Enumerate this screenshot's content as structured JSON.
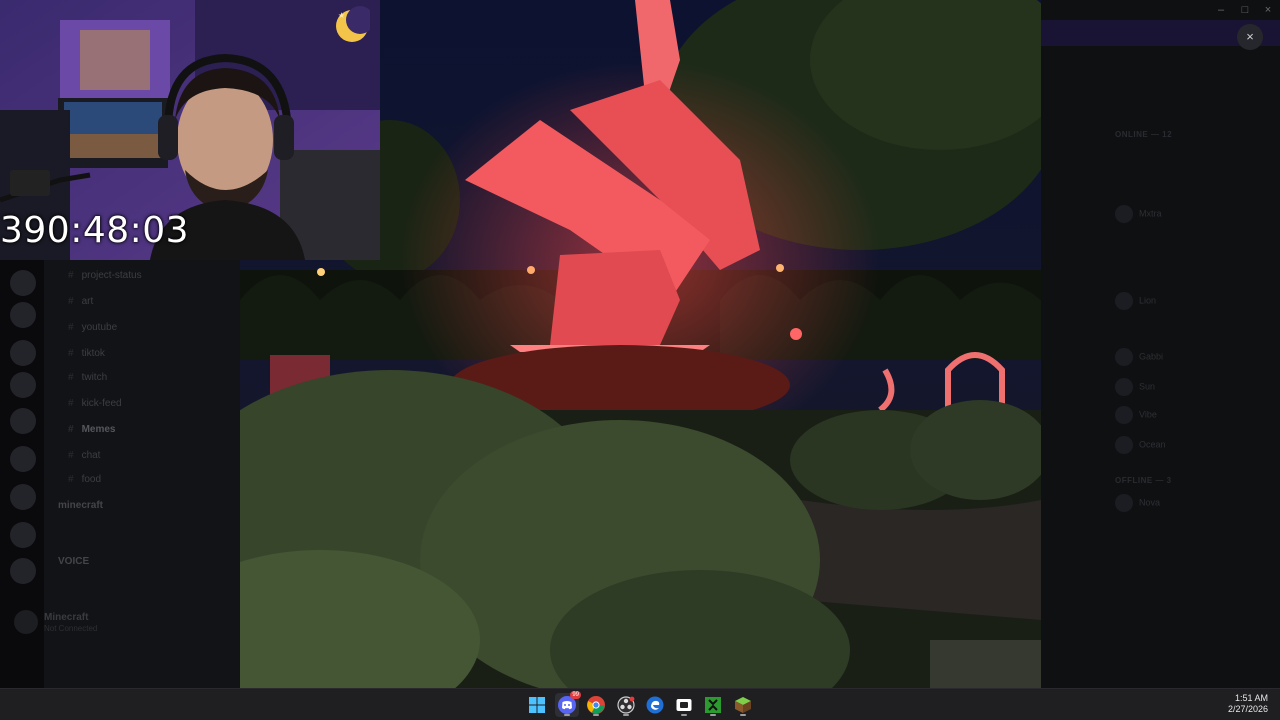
{
  "webcam": {
    "timer": "390:48:03"
  },
  "channels": {
    "items": [
      {
        "label": "project-status"
      },
      {
        "label": "art"
      },
      {
        "label": "youtube"
      },
      {
        "label": "tiktok"
      },
      {
        "label": "twitch"
      },
      {
        "label": "kick-feed"
      },
      {
        "label": "Memes"
      },
      {
        "label": "chat"
      },
      {
        "label": "food"
      }
    ],
    "categories": [
      "minecraft",
      "VOICE"
    ]
  },
  "server_footer": {
    "name": "Minecraft",
    "sub": "Not Connected"
  },
  "members": {
    "sections": [
      "ONLINE — 12",
      "OFFLINE — 3"
    ],
    "items": [
      {
        "name": "Mxtra"
      },
      {
        "name": "Lion"
      },
      {
        "name": "Gabbi"
      },
      {
        "name": "Sun"
      },
      {
        "name": "Vibe"
      },
      {
        "name": "Ocean"
      },
      {
        "name": "Nova"
      }
    ]
  },
  "overlay": {
    "close_symbol": "×"
  },
  "window_controls": {
    "minimize": "–",
    "maximize": "□",
    "close": "×"
  },
  "taskbar": {
    "apps": [
      {
        "icon": "windows-start-icon"
      },
      {
        "icon": "discord-icon",
        "badge": "99"
      },
      {
        "icon": "chrome-icon"
      },
      {
        "icon": "obs-icon"
      },
      {
        "icon": "edge-dev-icon"
      },
      {
        "icon": "camera-app-icon"
      },
      {
        "icon": "xbox-icon"
      },
      {
        "icon": "minecraft-icon"
      }
    ],
    "time": "1:51 AM",
    "date": "2/27/2026"
  },
  "colors": {
    "accent": "#5865f2",
    "sculpture": "#f25a5f",
    "webcam_bg": "#3a2a68"
  }
}
